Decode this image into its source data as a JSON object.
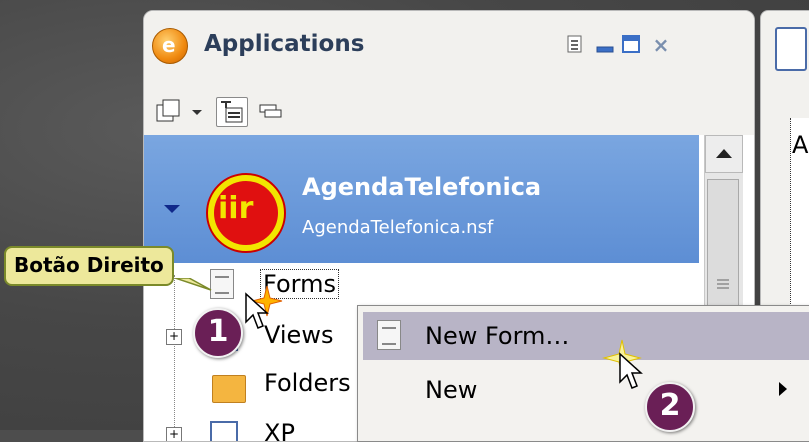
{
  "app": {
    "title": "Applications"
  },
  "window_controls": {
    "menu_label": "",
    "minimize_label": "",
    "maximize_label": "",
    "close_label": "×"
  },
  "database": {
    "name": "AgendaTelefonica",
    "file": "AgendaTelefonica.nsf",
    "icon_text": "iir"
  },
  "tree": {
    "items": [
      {
        "label": "Forms",
        "icon": "form-icon"
      },
      {
        "label": "Views",
        "icon": "view-icon"
      },
      {
        "label": "Folders",
        "icon": "folder-icon"
      },
      {
        "label": "XP",
        "icon": "xpage-icon"
      }
    ]
  },
  "context_menu": {
    "items": [
      {
        "label": "New Form…",
        "selected": true
      },
      {
        "label": "New",
        "has_submenu": true
      }
    ]
  },
  "callout": {
    "text": "Botão Direito"
  },
  "steps": {
    "one": "1",
    "two": "2"
  },
  "doc": {
    "letter": "A"
  },
  "colors": {
    "selection_blue": "#6b9bdb",
    "menu_highlight": "#b8b4c6",
    "badge": "#6a1f56",
    "callout_bg": "#ede89b"
  }
}
